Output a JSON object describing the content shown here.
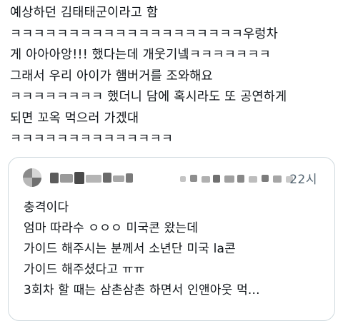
{
  "tweet": {
    "lines": [
      "예상하던 김태태군이라고 함",
      "ㅋㅋㅋㅋㅋㅋㅋㅋㅋㅋㅋㅋㅋㅋㅋㅋㅋㅋㅋㅋ우렁차",
      "게 아아아앙!!! 했다는데 개웃기넼ㅋㅋㅋㅋㅋㅋㅋ",
      "그래서 우리 아이가 햄버거를 조와해요",
      "ㅋㅋㅋㅋㅋㅋㅋㅋ  했더니 담에 혹시라도 또 공연하게",
      "되면 꼬옥 먹으러 가겠대",
      "ㅋㅋㅋㅋㅋㅋㅋㅋㅋㅋㅋㅋㅋㅋ"
    ]
  },
  "quote": {
    "timestamp": "22시",
    "lines": [
      "충격이다",
      "엄마 따라수 ㅇㅇㅇ 미국콘 왔는데",
      "가이드 해주시는 분께서 소년단 미국 la콘",
      "가이드 해주셨다고 ㅠㅠ",
      "3회차 할 때는 삼촌삼촌 하면서 인앤아웃 먹..."
    ]
  },
  "colors": {
    "text": "#0f1419",
    "muted": "#536471",
    "border": "#cfd9de"
  }
}
